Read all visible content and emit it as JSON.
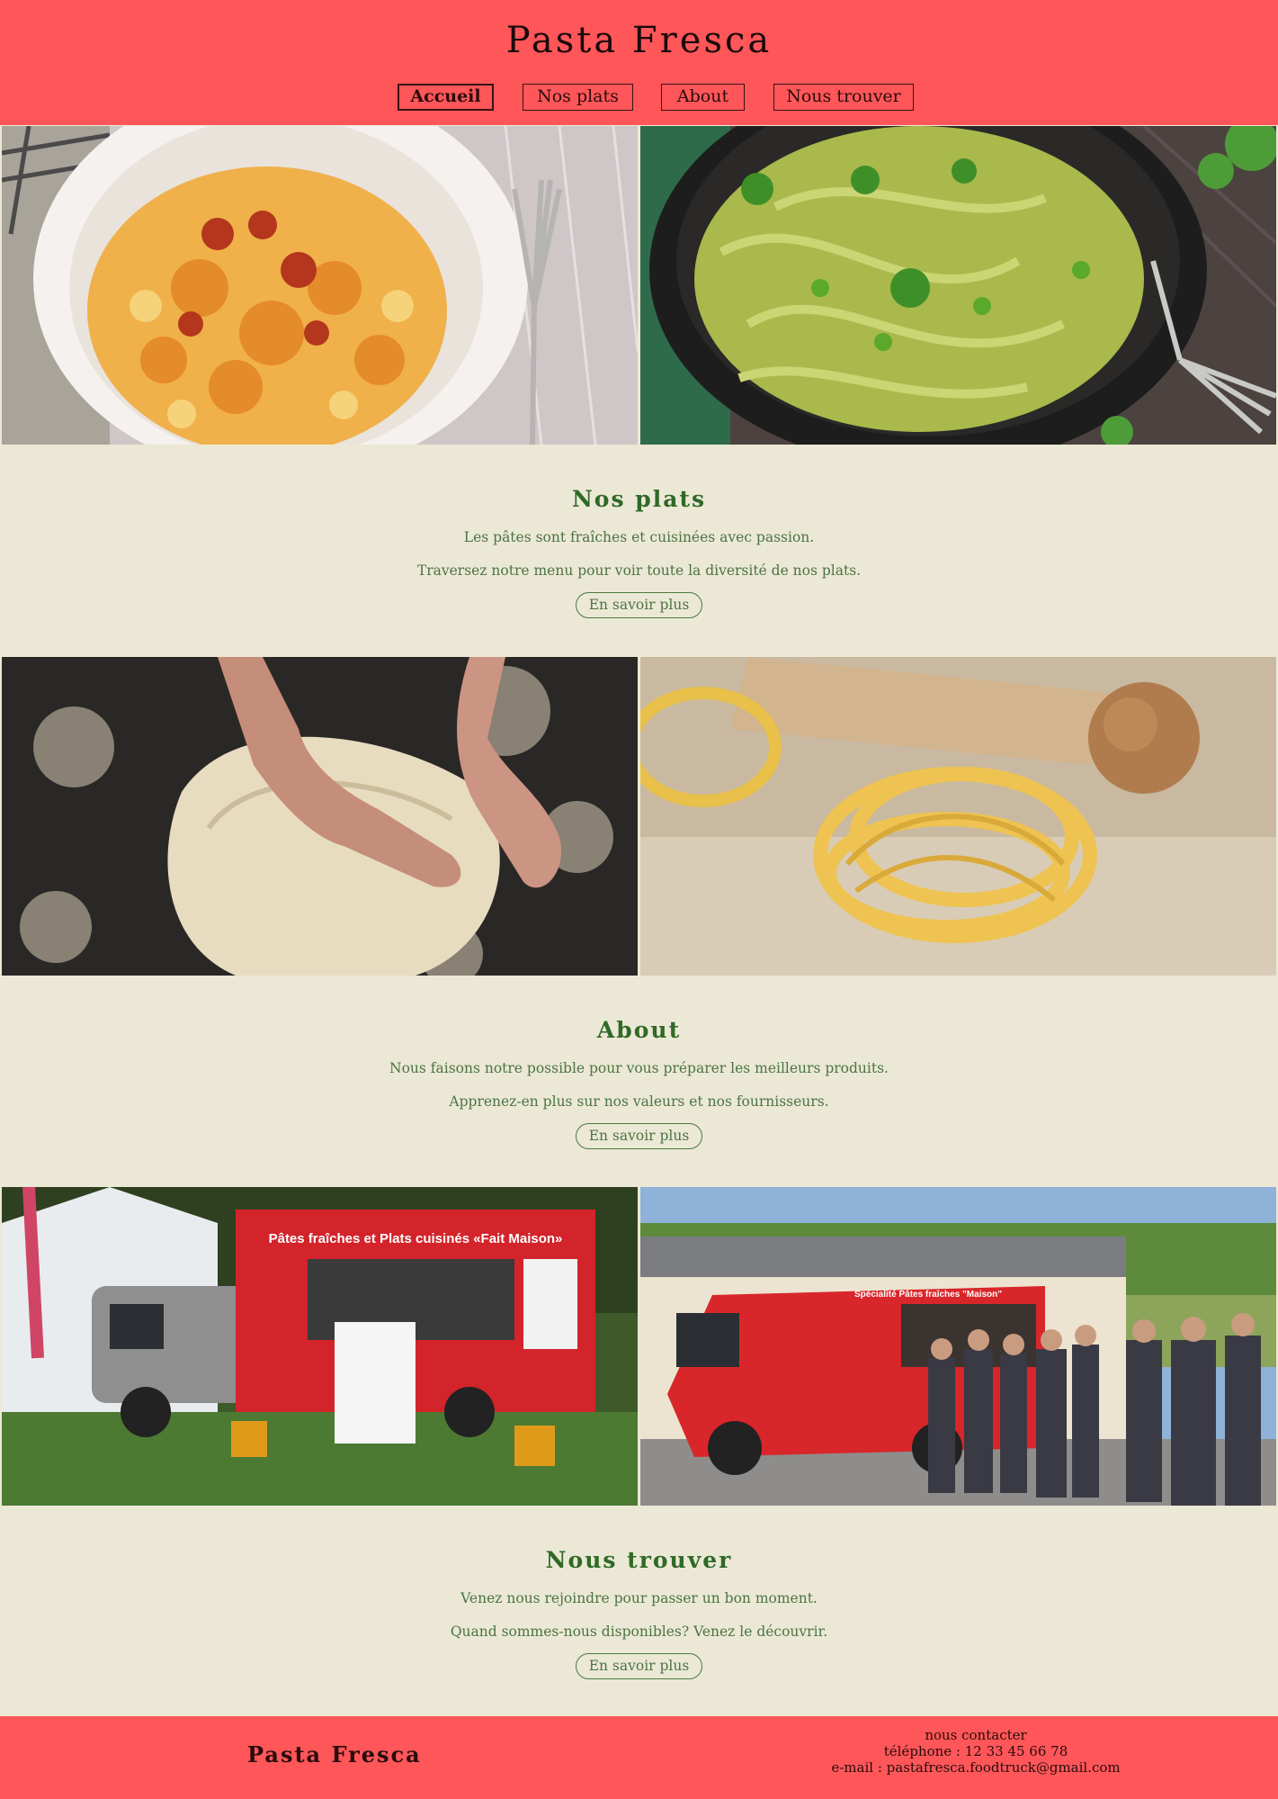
{
  "header": {
    "title": "Pasta Fresca",
    "nav": [
      {
        "label": "Accueil",
        "active": true
      },
      {
        "label": "Nos plats",
        "active": false
      },
      {
        "label": "About",
        "active": false
      },
      {
        "label": "Nous trouver",
        "active": false
      }
    ]
  },
  "sections": [
    {
      "title": "Nos plats",
      "line1": "Les pâtes sont fraîches et cuisinées avec passion.",
      "line2": "Traversez notre menu pour voir toute la diversité de nos plats.",
      "button": "En savoir plus"
    },
    {
      "title": "About",
      "line1": "Nous faisons notre possible pour vous préparer les meilleurs produits.",
      "line2": "Apprenez-en plus sur nos valeurs et nos fournisseurs.",
      "button": "En savoir plus"
    },
    {
      "title": "Nous trouver",
      "line1": "Venez nous rejoindre pour passer un bon moment.",
      "line2": "Quand sommes-nous disponibles? Venez le découvrir.",
      "button": "En savoir plus"
    }
  ],
  "truck_photo": {
    "banner_left": "Pâtes fraîches et Plats cuisinés «Fait Maison»",
    "banner_right": "Spécialité Pâtes fraîches \"Maison\""
  },
  "footer": {
    "brand": "Pasta Fresca",
    "contact_heading": "nous contacter",
    "phone": "téléphone : 12 33 45 66 78",
    "email": "e-mail : pastafresca.foodtruck@gmail.com"
  },
  "colors": {
    "header_bg": "#FE5659",
    "page_bg": "#ECE8D6",
    "section_title": "#2F6A26",
    "section_text": "#4B7542"
  }
}
